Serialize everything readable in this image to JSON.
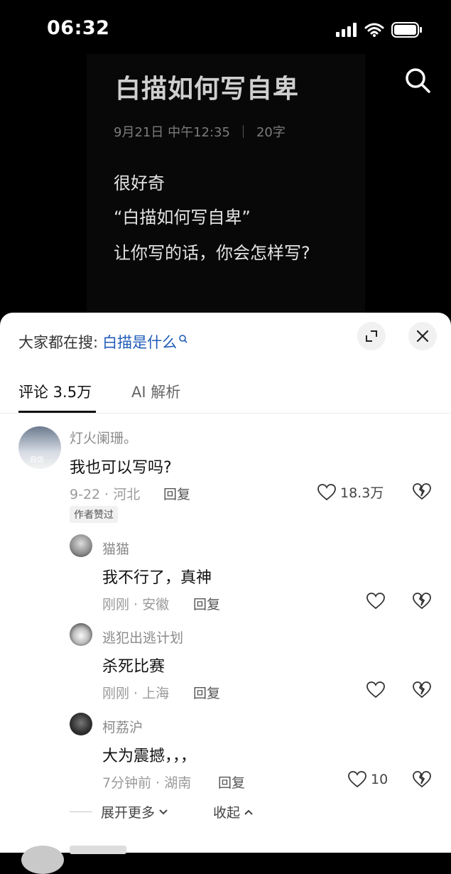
{
  "status_bar": {
    "time": "06:32",
    "icons": [
      "signal-icon",
      "wifi-icon",
      "battery-icon"
    ]
  },
  "note": {
    "title": "白描如何写自卑",
    "date": "9月21日 中午12:35",
    "word_count": "20字",
    "lines": [
      "很好奇",
      "“白描如何写自卑”",
      "让你写的话，你会怎样写?"
    ]
  },
  "sheet": {
    "search_prefix": "大家都在搜:",
    "search_keyword": "白描是什么",
    "tabs": [
      {
        "label": "评论 3.5万"
      },
      {
        "label": "AI 解析"
      }
    ]
  },
  "comments": [
    {
      "name": "灯火阑珊。",
      "text": "我也可以写吗?",
      "meta": "9-22 · 河北",
      "reply": "回复",
      "likes": "18.3万",
      "badge": "作者赞过",
      "avatar_text": "自信"
    },
    {
      "name": "猫猫",
      "text": "我不行了，真神",
      "meta": "刚刚 · 安徽",
      "reply": "回复",
      "likes": ""
    },
    {
      "name": "逃犯出逃计划",
      "text": "杀死比赛",
      "meta": "刚刚 · 上海",
      "reply": "回复",
      "likes": ""
    },
    {
      "name": "柯荔沪",
      "text": "大为震撼，，，",
      "meta": "7分钟前 · 湖南",
      "reply": "回复",
      "likes": "10"
    }
  ],
  "thread_controls": {
    "expand": "展开更多",
    "collapse": "收起"
  },
  "colors": {
    "keyword": "#1f5bb8",
    "sheet_bg": "#ffffff",
    "note_bg": "#080808"
  }
}
